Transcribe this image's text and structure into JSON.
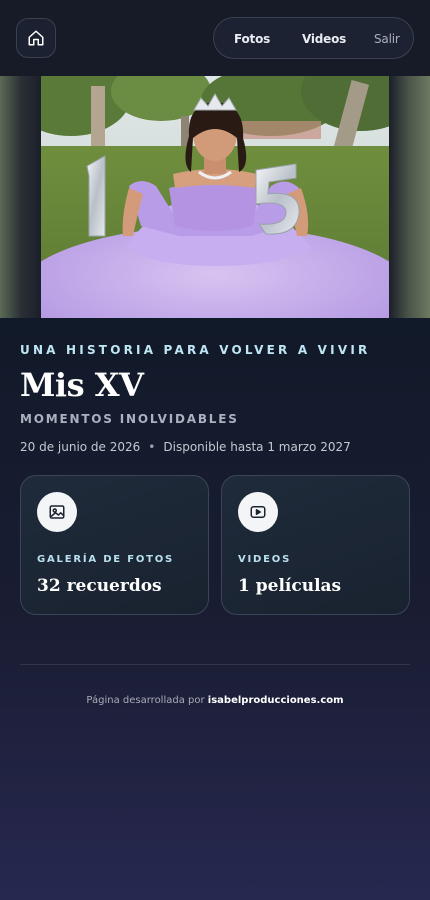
{
  "nav": {
    "home_icon": "home-icon",
    "items": [
      {
        "label": "Fotos"
      },
      {
        "label": "Videos"
      },
      {
        "label": "Salir"
      }
    ]
  },
  "hero": {
    "image_subject": "quinceañera girl in lavender gown with silver 1 and 5 balloons in a park"
  },
  "event": {
    "eyebrow": "UNA HISTORIA PARA VOLVER A VIVIR",
    "title": "Mis XV",
    "subtitle": "MOMENTOS INOLVIDABLES",
    "date": "20 de junio de 2026",
    "separator": "•",
    "availability": "Disponible hasta 1 marzo 2027"
  },
  "cards": [
    {
      "icon": "image-icon",
      "label": "GALERÍA DE FOTOS",
      "value": "32 recuerdos"
    },
    {
      "icon": "play-icon",
      "label": "VIDEOS",
      "value": "1 películas"
    }
  ],
  "footer": {
    "prefix": "Página desarrollada por",
    "brand": "isabelproducciones.com"
  }
}
